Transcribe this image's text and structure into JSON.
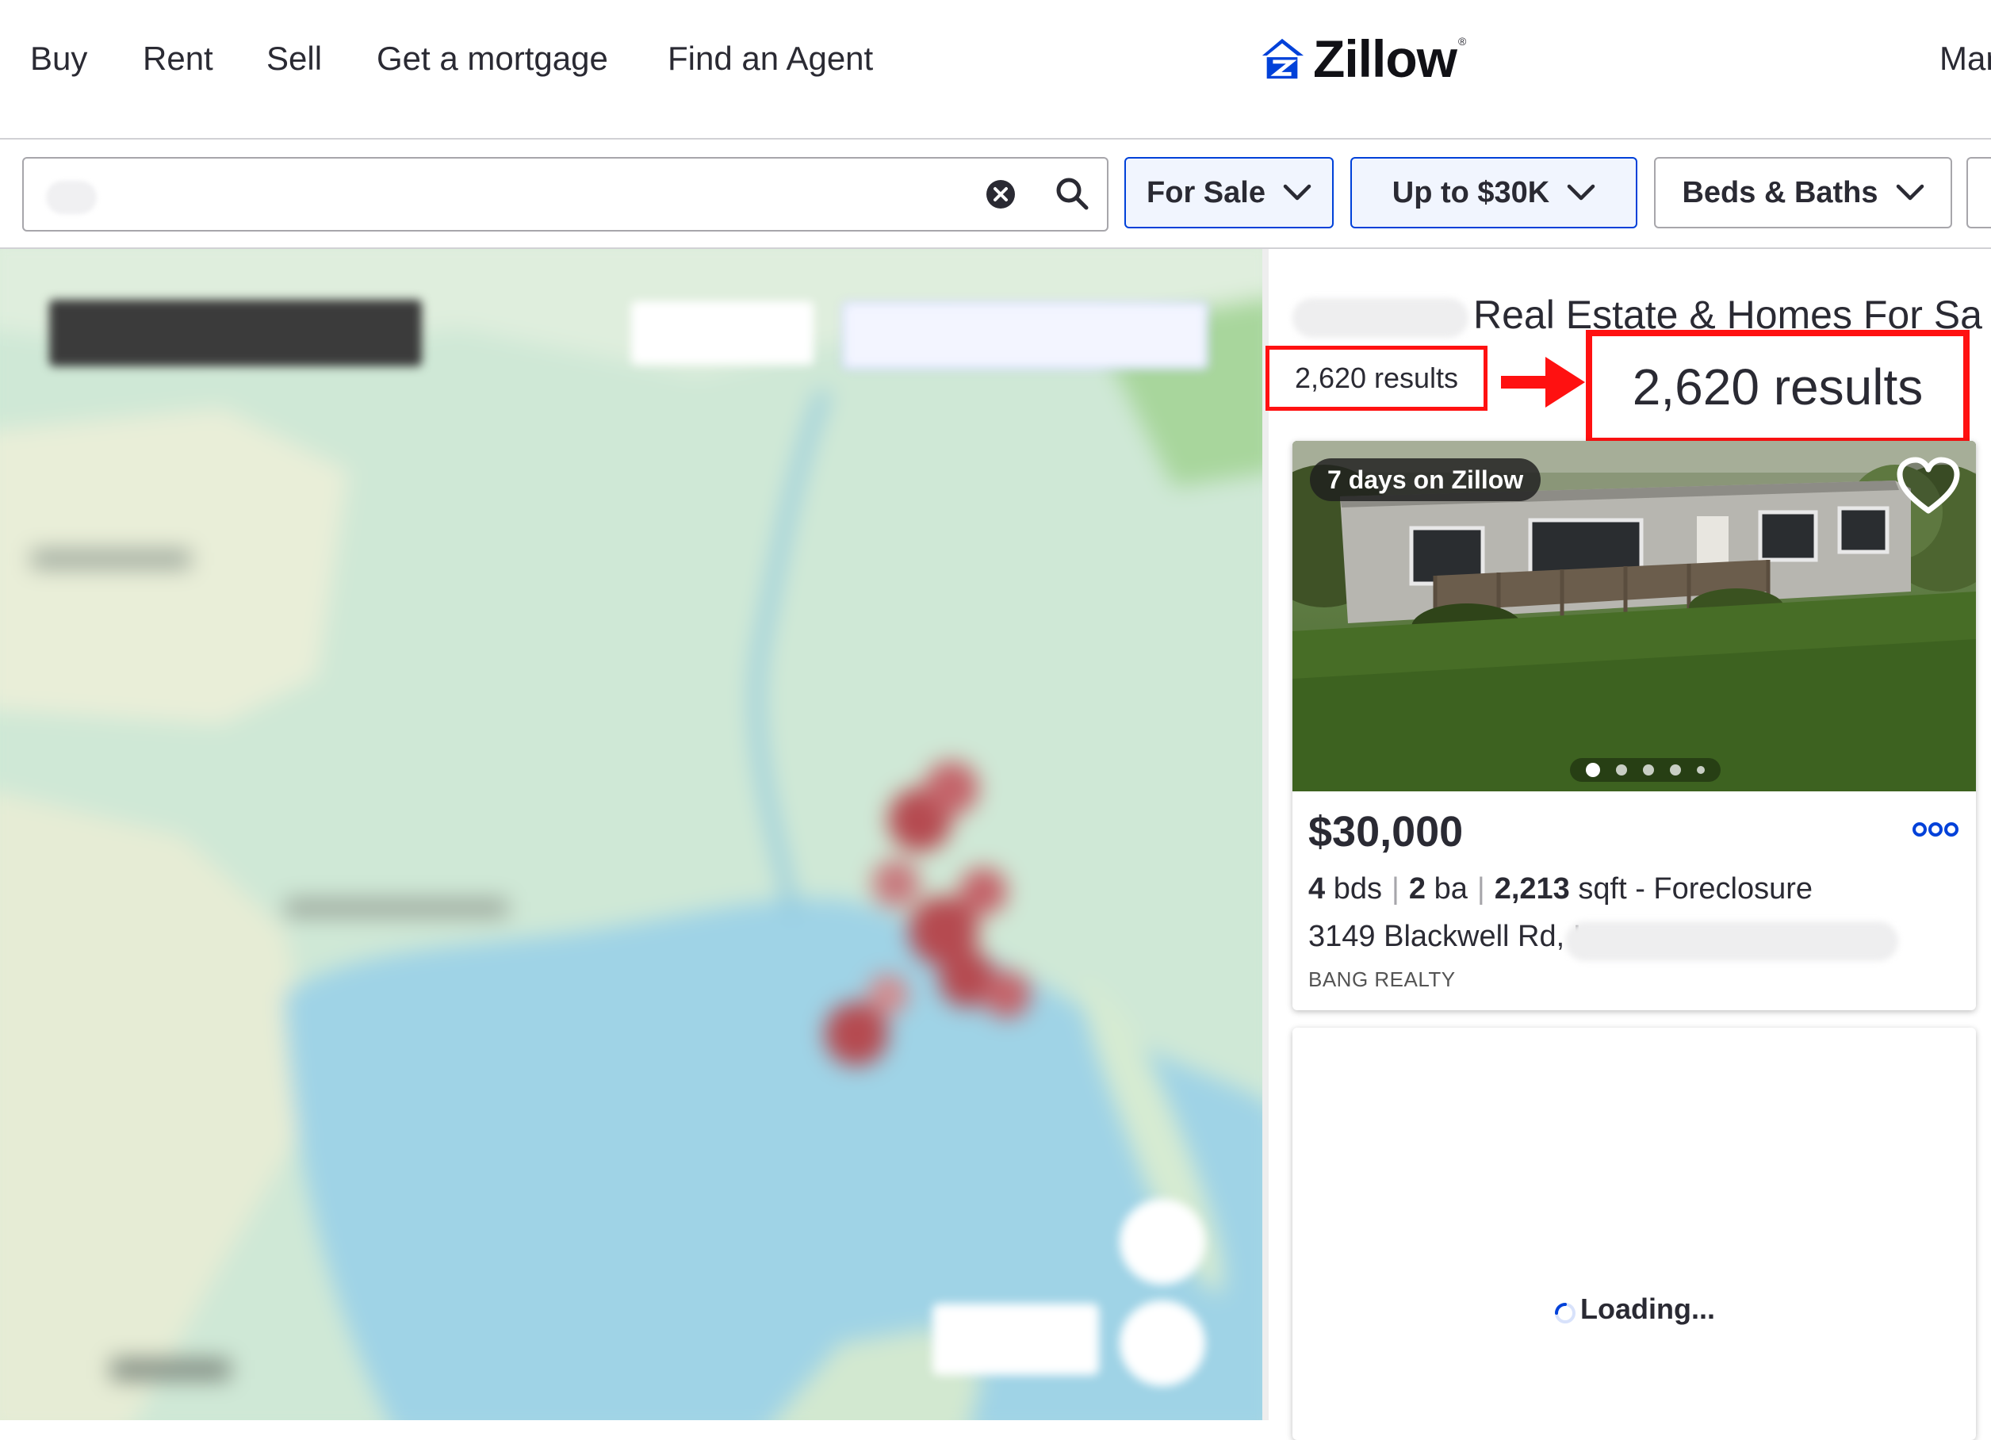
{
  "nav": {
    "items": [
      "Buy",
      "Rent",
      "Sell",
      "Get a mortgage",
      "Find an Agent"
    ],
    "right_partial": "Mar",
    "logo_text": "Zillow",
    "logo_mark": "®"
  },
  "search": {
    "value": "",
    "placeholder": ""
  },
  "filters": {
    "listing_type": "For Sale",
    "price": "Up to $30K",
    "beds_baths": "Beds & Baths"
  },
  "results": {
    "title": "Real Estate & Homes For Sa",
    "count": "2,620 results",
    "count_zoomed": "2,620 results"
  },
  "listing": {
    "badge": "7 days on Zillow",
    "price": "$30,000",
    "beds": "4",
    "beds_unit": "bds",
    "baths": "2",
    "baths_unit": "ba",
    "sqft": "2,213",
    "sqft_unit": "sqft",
    "status": "- Foreclosure",
    "address": "3149 Blackwell Rd, I",
    "broker": "BANG REALTY",
    "photo_count": 5,
    "current_photo": 1
  },
  "loading_card": {
    "text": "Loading..."
  },
  "colors": {
    "brand_blue": "#0041d9",
    "highlight_red": "#ff1111",
    "text": "#2a2a33"
  },
  "icons": {
    "clear": "clear-icon",
    "search": "search-icon",
    "chevron": "chevron-down-icon",
    "favorite": "heart-icon",
    "more": "more-icon",
    "spinner": "spinner-icon"
  }
}
